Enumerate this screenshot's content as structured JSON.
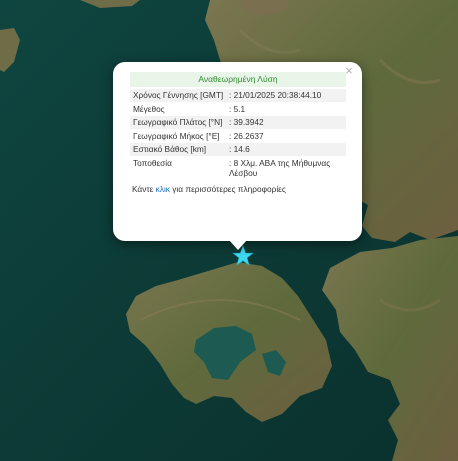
{
  "popup": {
    "title": "Αναθεωρημένη Λύση",
    "close_symbol": "×",
    "rows": [
      {
        "label": "Χρόνος Γέννησης [GMT]",
        "value": ": 21/01/2025 20:38:44.10"
      },
      {
        "label": "Μέγεθος",
        "value": ": 5.1"
      },
      {
        "label": "Γεωγραφικό Πλάτος [°N]",
        "value": ": 39.3942"
      },
      {
        "label": "Γεωγραφικό Μήκος [°E]",
        "value": ": 26.2637"
      },
      {
        "label": "Εστιακό Βάθος [km]",
        "value": ": 14.6"
      },
      {
        "label": "Τοποθεσία",
        "value": ": 8 Χλμ. ΑΒΑ της Μήθυμνας Λέσβου"
      }
    ],
    "more_prefix": "Κάντε ",
    "more_link": "κλικ",
    "more_suffix": " για περισσότερες πληροφορίες"
  },
  "marker": {
    "icon": "star-icon",
    "color": "#3fd8f0"
  },
  "colors": {
    "sea": "#0d3b36",
    "land": "#6e6a44",
    "link": "#1a6fc4",
    "title_text": "#2e8b2e"
  }
}
